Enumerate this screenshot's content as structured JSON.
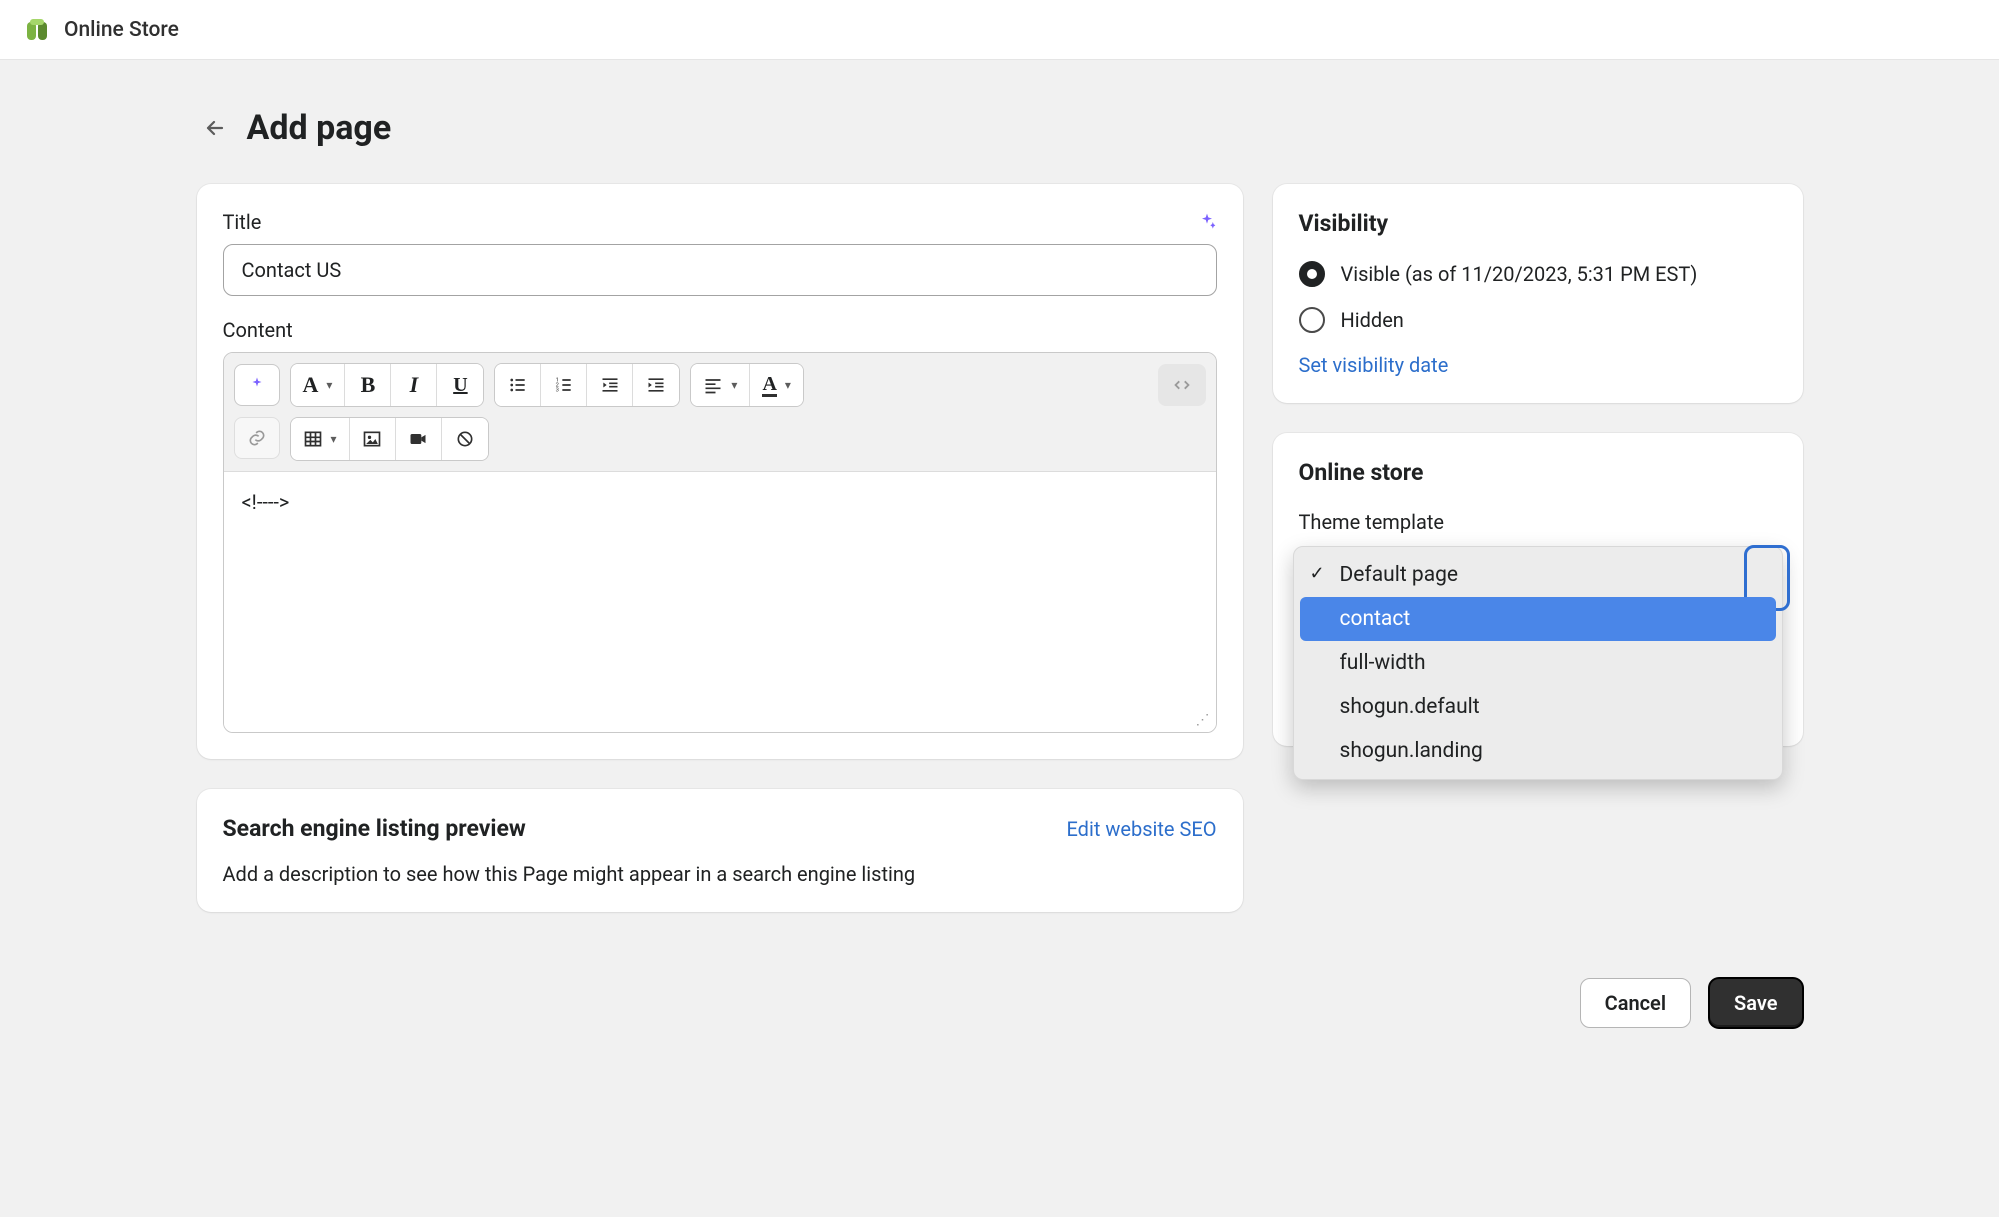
{
  "topbar": {
    "title": "Online Store"
  },
  "header": {
    "title": "Add page"
  },
  "titleField": {
    "label": "Title",
    "value": "Contact US"
  },
  "contentField": {
    "label": "Content",
    "body": "<!---->"
  },
  "seo": {
    "title": "Search engine listing preview",
    "edit_link": "Edit website SEO",
    "description": "Add a description to see how this Page might appear in a search engine listing"
  },
  "visibility": {
    "title": "Visibility",
    "visible_label": "Visible (as of 11/20/2023, 5:31 PM EST)",
    "hidden_label": "Hidden",
    "selected": "visible",
    "set_date_link": "Set visibility date"
  },
  "onlineStore": {
    "title": "Online store",
    "template_label": "Theme template",
    "selected": "Default page",
    "highlighted": "contact",
    "options": [
      "Default page",
      "contact",
      "full-width",
      "shogun.default",
      "shogun.landing"
    ]
  },
  "actions": {
    "cancel": "Cancel",
    "save": "Save"
  }
}
